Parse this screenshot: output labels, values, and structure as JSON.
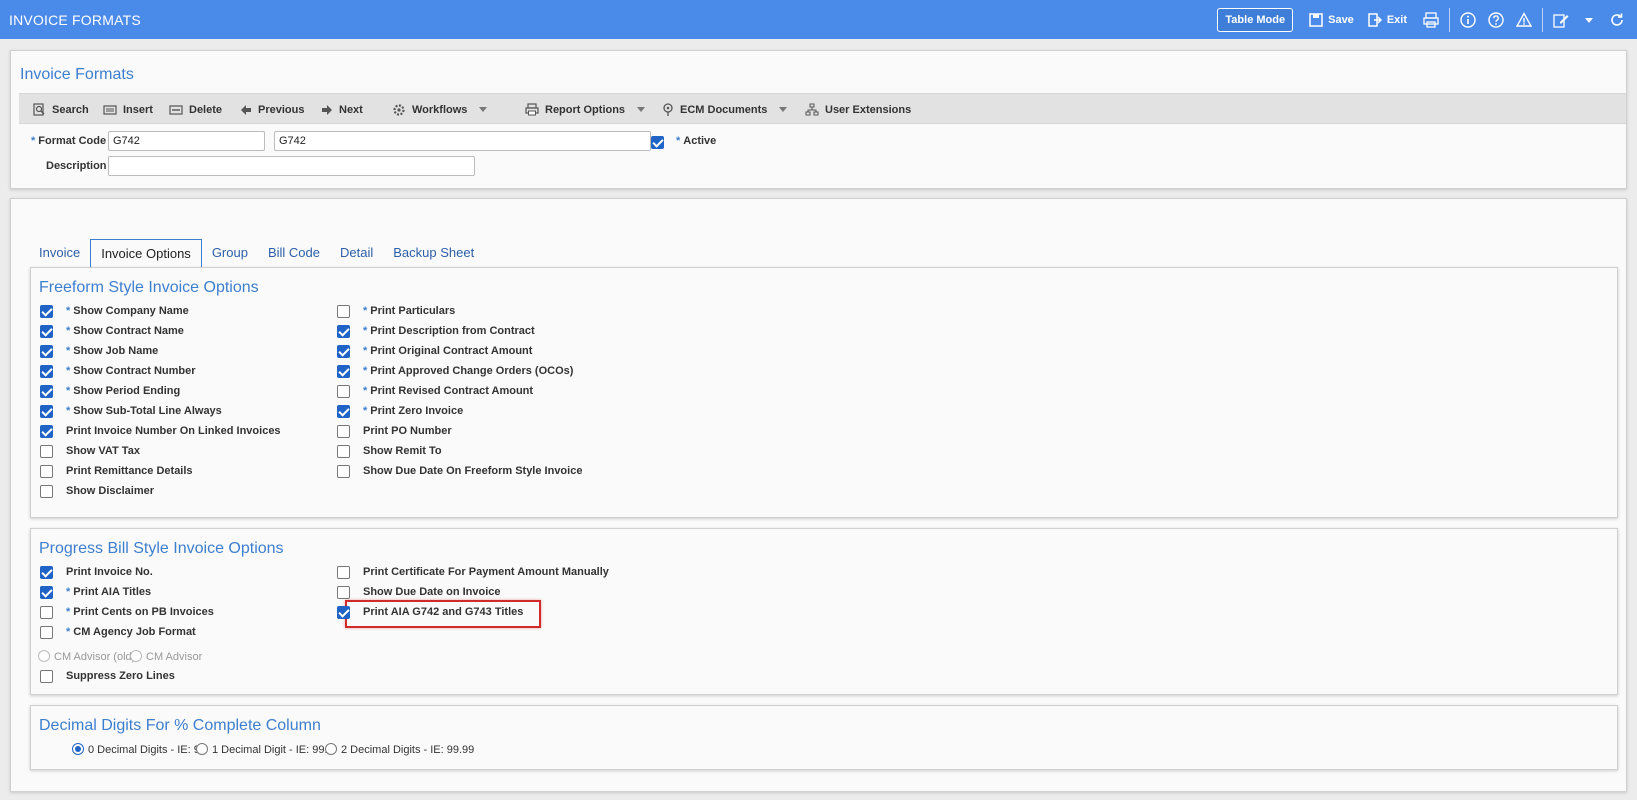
{
  "app": {
    "title": "INVOICE FORMATS",
    "table_mode_label": "Table Mode",
    "save_label": "Save",
    "exit_label": "Exit"
  },
  "header": {
    "title": "Invoice Formats",
    "toolbar": {
      "search": "Search",
      "insert": "Insert",
      "delete": "Delete",
      "previous": "Previous",
      "next": "Next",
      "workflows": "Workflows",
      "report_options": "Report Options",
      "ecm_documents": "ECM Documents",
      "user_extensions": "User Extensions"
    },
    "fields": {
      "required_marker": "*",
      "format_code_label": "Format Code",
      "format_code_value": "G742",
      "format_name_value": "G742",
      "active_label": "Active",
      "active_checked": true,
      "description_label": "Description",
      "description_value": ""
    }
  },
  "tabs": [
    "Invoice",
    "Invoice Options",
    "Group",
    "Bill Code",
    "Detail",
    "Backup Sheet"
  ],
  "active_tab": "Invoice Options",
  "freeform": {
    "title": "Freeform Style Invoice Options",
    "left": [
      {
        "label": "Show Company Name",
        "required": true,
        "checked": true
      },
      {
        "label": "Show Contract Name",
        "required": true,
        "checked": true
      },
      {
        "label": "Show Job Name",
        "required": true,
        "checked": true
      },
      {
        "label": "Show Contract Number",
        "required": true,
        "checked": true
      },
      {
        "label": "Show Period Ending",
        "required": true,
        "checked": true
      },
      {
        "label": "Show Sub-Total Line Always",
        "required": true,
        "checked": true
      },
      {
        "label": "Print Invoice Number On Linked Invoices",
        "required": false,
        "checked": true
      },
      {
        "label": "Show VAT Tax",
        "required": false,
        "checked": false
      },
      {
        "label": "Print Remittance Details",
        "required": false,
        "checked": false
      },
      {
        "label": "Show Disclaimer",
        "required": false,
        "checked": false
      }
    ],
    "right": [
      {
        "label": "Print Particulars",
        "required": true,
        "checked": false
      },
      {
        "label": "Print Description from Contract",
        "required": true,
        "checked": true
      },
      {
        "label": "Print Original Contract Amount",
        "required": true,
        "checked": true
      },
      {
        "label": "Print Approved Change Orders (OCOs)",
        "required": true,
        "checked": true
      },
      {
        "label": "Print Revised Contract Amount",
        "required": true,
        "checked": false
      },
      {
        "label": "Print Zero Invoice",
        "required": true,
        "checked": true
      },
      {
        "label": "Print PO Number",
        "required": false,
        "checked": false
      },
      {
        "label": "Show Remit To",
        "required": false,
        "checked": false
      },
      {
        "label": "Show Due Date On Freeform Style Invoice",
        "required": false,
        "checked": false
      }
    ]
  },
  "progress": {
    "title": "Progress Bill Style Invoice Options",
    "left": [
      {
        "label": "Print Invoice No.",
        "required": false,
        "checked": true
      },
      {
        "label": "Print AIA Titles",
        "required": true,
        "checked": true
      },
      {
        "label": "Print Cents on PB Invoices",
        "required": true,
        "checked": false
      },
      {
        "label": "CM Agency Job Format",
        "required": true,
        "checked": false
      }
    ],
    "cm_radios": [
      "CM Advisor (old)",
      "CM Advisor"
    ],
    "suppress": {
      "label": "Suppress Zero Lines",
      "checked": false
    },
    "right": [
      {
        "label": "Print Certificate For Payment Amount Manually",
        "checked": false
      },
      {
        "label": "Show Due Date on Invoice",
        "checked": false
      },
      {
        "label": "Print AIA G742 and G743 Titles",
        "checked": true,
        "highlighted": true
      }
    ]
  },
  "decimal": {
    "title": "Decimal Digits For % Complete Column",
    "options": [
      "0 Decimal Digits - IE: 99",
      "1 Decimal Digit - IE: 99.9",
      "2 Decimal Digits - IE: 99.99"
    ],
    "selected": 0
  }
}
